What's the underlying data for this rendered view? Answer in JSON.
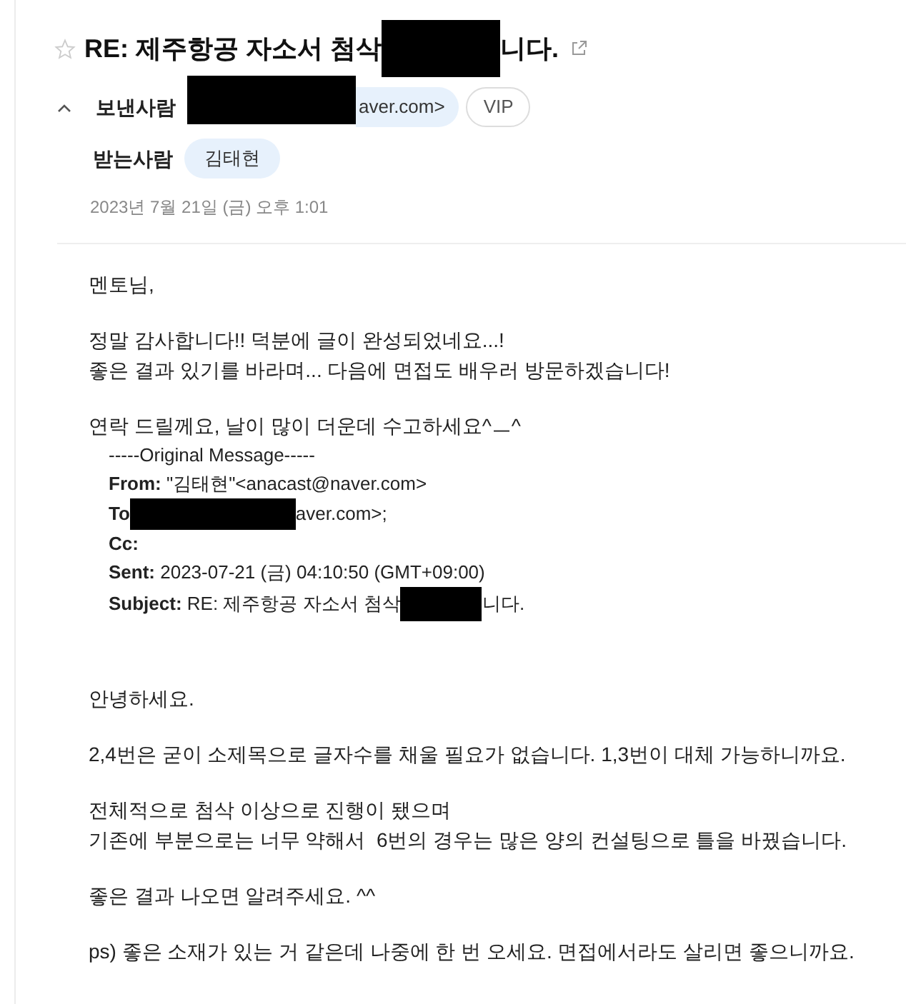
{
  "header": {
    "starred": false,
    "subject_parts": [
      "RE: 제주항공 자소서 첨삭",
      "니다."
    ],
    "sender": {
      "label": "보낸사람",
      "address_tail": "aver.com>",
      "badge": "VIP"
    },
    "recipient": {
      "label": "받는사람",
      "name": "김태현"
    },
    "date": "2023년 7월 21일 (금) 오후 1:01"
  },
  "body_top": [
    [
      "멘토님,"
    ],
    [
      "정말 감사합니다!! 덕분에 글이 완성되었네요...!",
      "좋은 결과 있기를 바라며... 다음에 면접도 배우러 방문하겠습니다!"
    ],
    [
      "연락 드릴께요, 날이 많이 더운데 수고하세요^ㅡ^"
    ]
  ],
  "quote": {
    "divider": "-----Original Message-----",
    "fields": [
      {
        "kind": "text",
        "label": "From:",
        "value": "\"김태현\"<anacast@naver.com>"
      },
      {
        "kind": "redacted",
        "label": "To",
        "value": "aver.com>;"
      },
      {
        "kind": "text",
        "label": "Cc:"
      },
      {
        "kind": "text",
        "label": "Sent:",
        "value": "2023-07-21 (금) 04:10:50 (GMT+09:00)"
      },
      {
        "kind": "subject",
        "label": "Subject:",
        "value": "RE: 제주항공 자소서 첨삭",
        "tail": "니다."
      }
    ]
  },
  "body_bottom": [
    [
      "안녕하세요."
    ],
    [
      "2,4번은 굳이 소제목으로 글자수를 채울 필요가 없습니다. 1,3번이 대체 가능하니까요."
    ],
    [
      "전체적으로 첨삭 이상으로 진행이 됐으며",
      "기존에 부분으로는 너무 약해서  6번의 경우는 많은 양의 컨설팅으로 틀을 바꿨습니다."
    ],
    [
      "좋은 결과 나오면 알려주세요. ^^"
    ],
    [
      "ps) 좋은 소재가 있는 거 같은데 나중에 한 번 오세요. 면접에서라도 살리면 좋으니까요."
    ]
  ]
}
